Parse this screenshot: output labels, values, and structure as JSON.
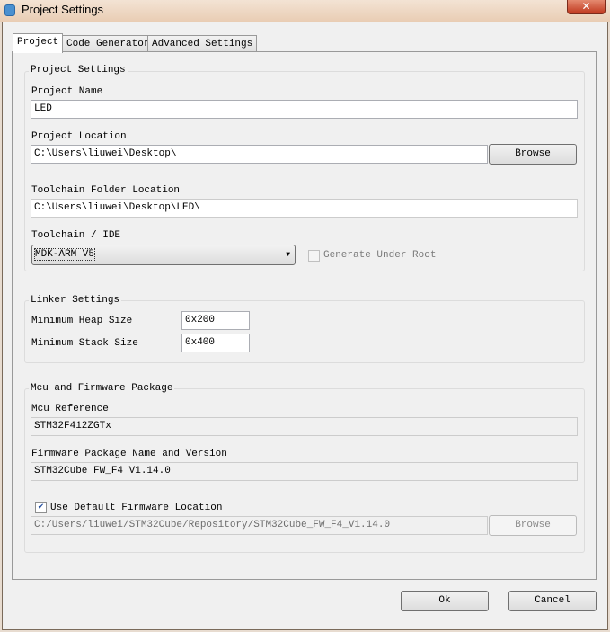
{
  "window": {
    "title": "Project Settings",
    "close_label": "✕"
  },
  "tabs": [
    {
      "label": "Project"
    },
    {
      "label": "Code Generator"
    },
    {
      "label": "Advanced Settings"
    }
  ],
  "project_settings": {
    "group_label": "Project Settings",
    "project_name_label": "Project Name",
    "project_name": "LED",
    "project_location_label": "Project Location",
    "project_location": "C:\\Users\\liuwei\\Desktop\\",
    "browse_label": "Browse",
    "toolchain_folder_label": "Toolchain Folder Location",
    "toolchain_folder": "C:\\Users\\liuwei\\Desktop\\LED\\",
    "toolchain_label": "Toolchain / IDE",
    "toolchain_value": "MDK-ARM V5",
    "generate_under_root_label": "Generate Under Root"
  },
  "linker_settings": {
    "group_label": "Linker Settings",
    "heap_label": "Minimum Heap Size",
    "heap_value": "0x200",
    "stack_label": "Minimum Stack Size",
    "stack_value": "0x400"
  },
  "mcu_firmware": {
    "group_label": "Mcu and Firmware Package",
    "mcu_ref_label": "Mcu Reference",
    "mcu_ref": "STM32F412ZGTx",
    "fw_label": "Firmware Package Name and Version",
    "fw_value": "STM32Cube FW_F4 V1.14.0",
    "use_default_label": "Use Default Firmware Location",
    "fw_location": "C:/Users/liuwei/STM32Cube/Repository/STM32Cube_FW_F4_V1.14.0",
    "browse_label": "Browse"
  },
  "footer": {
    "ok_label": "Ok",
    "cancel_label": "Cancel"
  }
}
